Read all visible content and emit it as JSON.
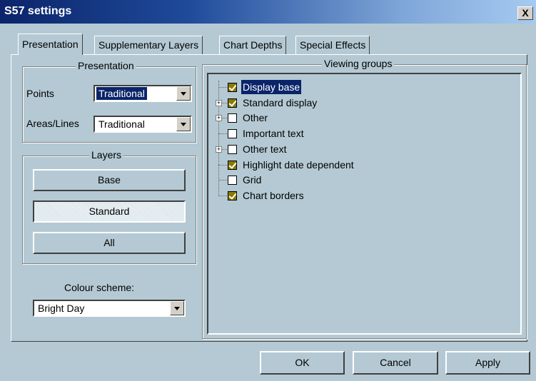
{
  "window": {
    "title": "S57 settings",
    "close_label": "X"
  },
  "tabs": [
    {
      "label": "Presentation",
      "active": true
    },
    {
      "label": "Supplementary Layers",
      "active": false
    },
    {
      "label": "Chart Depths",
      "active": false
    },
    {
      "label": "Special Effects",
      "active": false
    }
  ],
  "presentation": {
    "legend": "Presentation",
    "points_label": "Points",
    "points_value": "Traditional",
    "areas_label": "Areas/Lines",
    "areas_value": "Traditional"
  },
  "layers": {
    "legend": "Layers",
    "base_label": "Base",
    "standard_label": "Standard",
    "all_label": "All"
  },
  "colour_scheme": {
    "label": "Colour scheme:",
    "value": "Bright Day"
  },
  "viewing_groups": {
    "legend": "Viewing groups",
    "items": [
      {
        "label": "Display base",
        "checked": true,
        "expandable": false,
        "selected": true
      },
      {
        "label": "Standard display",
        "checked": true,
        "expandable": true,
        "selected": false
      },
      {
        "label": "Other",
        "checked": false,
        "expandable": true,
        "selected": false
      },
      {
        "label": "Important text",
        "checked": false,
        "expandable": false,
        "selected": false
      },
      {
        "label": "Other text",
        "checked": false,
        "expandable": true,
        "selected": false
      },
      {
        "label": "Highlight date dependent",
        "checked": true,
        "expandable": false,
        "selected": false
      },
      {
        "label": "Grid",
        "checked": false,
        "expandable": false,
        "selected": false
      },
      {
        "label": "Chart borders",
        "checked": true,
        "expandable": false,
        "selected": false
      }
    ]
  },
  "buttons": {
    "ok": "OK",
    "cancel": "Cancel",
    "apply": "Apply"
  },
  "colors": {
    "title_bar": "#0b246a",
    "dialog_bg": "#b4c9d3",
    "selection": "#0a246a",
    "checkbox_checked": "#8a7a00"
  }
}
